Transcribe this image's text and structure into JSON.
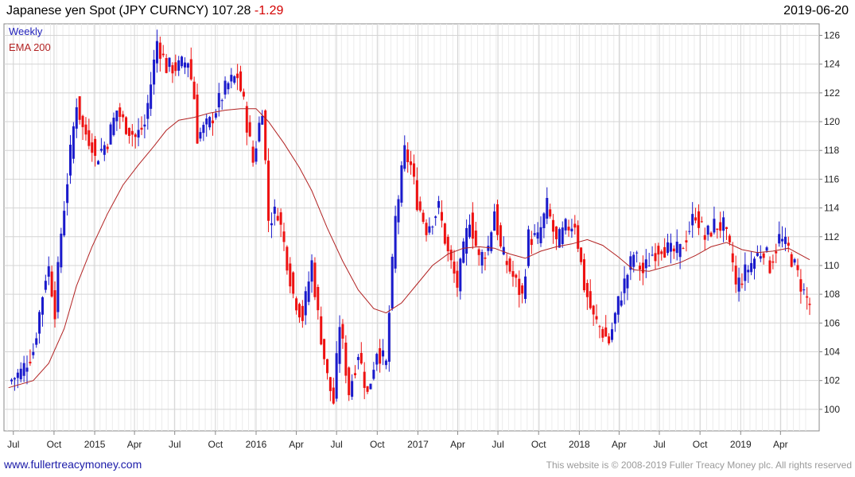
{
  "header": {
    "title": "Japanese yen Spot (JPY CURNCY)",
    "last_price": "107.28",
    "change": "-1.29",
    "date": "2019-06-20"
  },
  "legend": {
    "series1": "Weekly",
    "series2": "EMA 200"
  },
  "footer": {
    "left": "www.fullertreacymoney.com",
    "right": "This website is © 2008-2019 Fuller Treacy Money plc. All rights reserved"
  },
  "colors": {
    "up": "#1a1acc",
    "down": "#ee1111",
    "ema": "#b22222",
    "grid": "#d4d4d4",
    "axis": "#888888",
    "tick_text": "#222222"
  },
  "chart_data": {
    "type": "line",
    "x_axis": {
      "range": [
        "2014-07-01",
        "2019-06-20"
      ],
      "ticks": [
        {
          "date": "2014-07-15",
          "label": "Jul"
        },
        {
          "date": "2014-10-15",
          "label": "Oct"
        },
        {
          "date": "2015-01-15",
          "label": "2015"
        },
        {
          "date": "2015-04-15",
          "label": "Apr"
        },
        {
          "date": "2015-07-15",
          "label": "Jul"
        },
        {
          "date": "2015-10-15",
          "label": "Oct"
        },
        {
          "date": "2016-01-15",
          "label": "2016"
        },
        {
          "date": "2016-04-15",
          "label": "Apr"
        },
        {
          "date": "2016-07-15",
          "label": "Jul"
        },
        {
          "date": "2016-10-15",
          "label": "Oct"
        },
        {
          "date": "2017-01-15",
          "label": "2017"
        },
        {
          "date": "2017-04-15",
          "label": "Apr"
        },
        {
          "date": "2017-07-15",
          "label": "Jul"
        },
        {
          "date": "2017-10-15",
          "label": "Oct"
        },
        {
          "date": "2018-01-15",
          "label": "2018"
        },
        {
          "date": "2018-04-15",
          "label": "Apr"
        },
        {
          "date": "2018-07-15",
          "label": "Jul"
        },
        {
          "date": "2018-10-15",
          "label": "Oct"
        },
        {
          "date": "2019-01-15",
          "label": "2019"
        },
        {
          "date": "2019-04-15",
          "label": "Apr"
        }
      ]
    },
    "y_axis": {
      "min": 98.5,
      "max": 126.8,
      "ticks": [
        100,
        102,
        104,
        106,
        108,
        110,
        112,
        114,
        116,
        118,
        120,
        122,
        124,
        126
      ],
      "position": "right"
    },
    "grid": true,
    "legend_placement": "top-left",
    "series": [
      {
        "name": "Weekly",
        "style": "candlestick",
        "points": [
          [
            "2014-07-04",
            101.9
          ],
          [
            "2014-08-01",
            102.6
          ],
          [
            "2014-08-29",
            104.1
          ],
          [
            "2014-09-26",
            109.3
          ],
          [
            "2014-10-03",
            109.8
          ],
          [
            "2014-10-17",
            106.9
          ],
          [
            "2014-10-31",
            112.3
          ],
          [
            "2014-11-21",
            117.8
          ],
          [
            "2014-12-05",
            121.4
          ],
          [
            "2014-12-19",
            119.5
          ],
          [
            "2015-01-09",
            118.5
          ],
          [
            "2015-01-16",
            117.4
          ],
          [
            "2015-02-13",
            118.7
          ],
          [
            "2015-03-06",
            120.8
          ],
          [
            "2015-03-20",
            120.0
          ],
          [
            "2015-04-17",
            118.9
          ],
          [
            "2015-05-08",
            119.8
          ],
          [
            "2015-05-29",
            124.1
          ],
          [
            "2015-06-05",
            125.6
          ],
          [
            "2015-06-26",
            123.8
          ],
          [
            "2015-07-24",
            123.8
          ],
          [
            "2015-08-14",
            124.3
          ],
          [
            "2015-08-28",
            121.7
          ],
          [
            "2015-09-04",
            119.0
          ],
          [
            "2015-10-02",
            119.9
          ],
          [
            "2015-10-23",
            121.4
          ],
          [
            "2015-11-13",
            122.6
          ],
          [
            "2015-12-04",
            123.2
          ],
          [
            "2015-12-18",
            121.2
          ],
          [
            "2016-01-08",
            117.2
          ],
          [
            "2016-01-29",
            121.1
          ],
          [
            "2016-02-12",
            113.2
          ],
          [
            "2016-03-04",
            113.8
          ],
          [
            "2016-03-18",
            111.5
          ],
          [
            "2016-04-08",
            108.0
          ],
          [
            "2016-04-29",
            106.4
          ],
          [
            "2016-05-20",
            110.2
          ],
          [
            "2016-06-03",
            106.5
          ],
          [
            "2016-06-24",
            102.2
          ],
          [
            "2016-07-08",
            100.5
          ],
          [
            "2016-07-22",
            106.0
          ],
          [
            "2016-08-12",
            101.2
          ],
          [
            "2016-09-02",
            104.0
          ],
          [
            "2016-09-23",
            101.0
          ],
          [
            "2016-10-14",
            104.2
          ],
          [
            "2016-11-04",
            103.1
          ],
          [
            "2016-11-11",
            106.7
          ],
          [
            "2016-11-25",
            113.2
          ],
          [
            "2016-12-16",
            117.9
          ],
          [
            "2016-12-30",
            116.9
          ],
          [
            "2017-01-13",
            114.5
          ],
          [
            "2017-02-03",
            112.6
          ],
          [
            "2017-03-03",
            114.0
          ],
          [
            "2017-03-24",
            110.8
          ],
          [
            "2017-04-14",
            108.6
          ],
          [
            "2017-05-12",
            113.4
          ],
          [
            "2017-06-02",
            110.4
          ],
          [
            "2017-06-23",
            111.3
          ],
          [
            "2017-07-07",
            113.9
          ],
          [
            "2017-07-21",
            111.1
          ],
          [
            "2017-08-18",
            109.2
          ],
          [
            "2017-09-08",
            107.8
          ],
          [
            "2017-09-22",
            112.0
          ],
          [
            "2017-10-13",
            111.8
          ],
          [
            "2017-11-03",
            114.1
          ],
          [
            "2017-11-24",
            111.5
          ],
          [
            "2017-12-15",
            112.6
          ],
          [
            "2018-01-05",
            113.0
          ],
          [
            "2018-01-26",
            108.6
          ],
          [
            "2018-02-16",
            106.3
          ],
          [
            "2018-03-02",
            105.7
          ],
          [
            "2018-03-23",
            104.7
          ],
          [
            "2018-04-13",
            107.4
          ],
          [
            "2018-05-18",
            110.8
          ],
          [
            "2018-06-08",
            109.5
          ],
          [
            "2018-06-29",
            110.8
          ],
          [
            "2018-07-20",
            111.4
          ],
          [
            "2018-08-10",
            110.9
          ],
          [
            "2018-08-31",
            111.0
          ],
          [
            "2018-09-21",
            112.6
          ],
          [
            "2018-10-05",
            113.7
          ],
          [
            "2018-10-26",
            111.9
          ],
          [
            "2018-11-16",
            112.8
          ],
          [
            "2018-12-07",
            112.7
          ],
          [
            "2018-12-28",
            110.2
          ],
          [
            "2019-01-04",
            108.5
          ],
          [
            "2019-01-25",
            109.5
          ],
          [
            "2019-02-15",
            110.5
          ],
          [
            "2019-03-08",
            111.2
          ],
          [
            "2019-03-22",
            110.0
          ],
          [
            "2019-04-12",
            111.9
          ],
          [
            "2019-05-03",
            111.1
          ],
          [
            "2019-05-24",
            109.3
          ],
          [
            "2019-06-07",
            108.1
          ],
          [
            "2019-06-20",
            107.28
          ]
        ]
      },
      {
        "name": "EMA 200",
        "style": "line",
        "points": [
          [
            "2014-07-04",
            101.5
          ],
          [
            "2014-08-29",
            102.0
          ],
          [
            "2014-10-03",
            103.2
          ],
          [
            "2014-11-07",
            105.6
          ],
          [
            "2014-12-05",
            108.6
          ],
          [
            "2015-01-09",
            111.3
          ],
          [
            "2015-02-13",
            113.6
          ],
          [
            "2015-03-20",
            115.6
          ],
          [
            "2015-04-24",
            117.0
          ],
          [
            "2015-05-29",
            118.3
          ],
          [
            "2015-06-26",
            119.4
          ],
          [
            "2015-07-24",
            120.1
          ],
          [
            "2015-08-28",
            120.3
          ],
          [
            "2015-10-02",
            120.6
          ],
          [
            "2015-11-06",
            120.8
          ],
          [
            "2015-12-11",
            120.9
          ],
          [
            "2016-01-15",
            120.9
          ],
          [
            "2016-02-12",
            120.0
          ],
          [
            "2016-03-18",
            118.5
          ],
          [
            "2016-04-22",
            116.8
          ],
          [
            "2016-05-20",
            115.2
          ],
          [
            "2016-06-24",
            112.6
          ],
          [
            "2016-07-29",
            110.3
          ],
          [
            "2016-09-02",
            108.3
          ],
          [
            "2016-10-07",
            107.0
          ],
          [
            "2016-11-04",
            106.7
          ],
          [
            "2016-12-09",
            107.4
          ],
          [
            "2017-01-13",
            108.7
          ],
          [
            "2017-02-17",
            110.0
          ],
          [
            "2017-03-24",
            110.8
          ],
          [
            "2017-04-28",
            111.2
          ],
          [
            "2017-06-02",
            111.3
          ],
          [
            "2017-07-07",
            111.2
          ],
          [
            "2017-08-11",
            110.8
          ],
          [
            "2017-09-15",
            110.5
          ],
          [
            "2017-10-20",
            111.0
          ],
          [
            "2017-11-24",
            111.3
          ],
          [
            "2017-12-29",
            111.5
          ],
          [
            "2018-02-02",
            111.8
          ],
          [
            "2018-03-09",
            111.4
          ],
          [
            "2018-04-13",
            110.6
          ],
          [
            "2018-05-18",
            109.7
          ],
          [
            "2018-06-22",
            109.6
          ],
          [
            "2018-07-27",
            109.9
          ],
          [
            "2018-08-31",
            110.2
          ],
          [
            "2018-10-05",
            110.7
          ],
          [
            "2018-11-09",
            111.3
          ],
          [
            "2018-12-14",
            111.6
          ],
          [
            "2019-01-18",
            111.1
          ],
          [
            "2019-02-22",
            110.9
          ],
          [
            "2019-03-29",
            111.0
          ],
          [
            "2019-05-03",
            111.2
          ],
          [
            "2019-06-20",
            110.4
          ]
        ]
      }
    ]
  }
}
